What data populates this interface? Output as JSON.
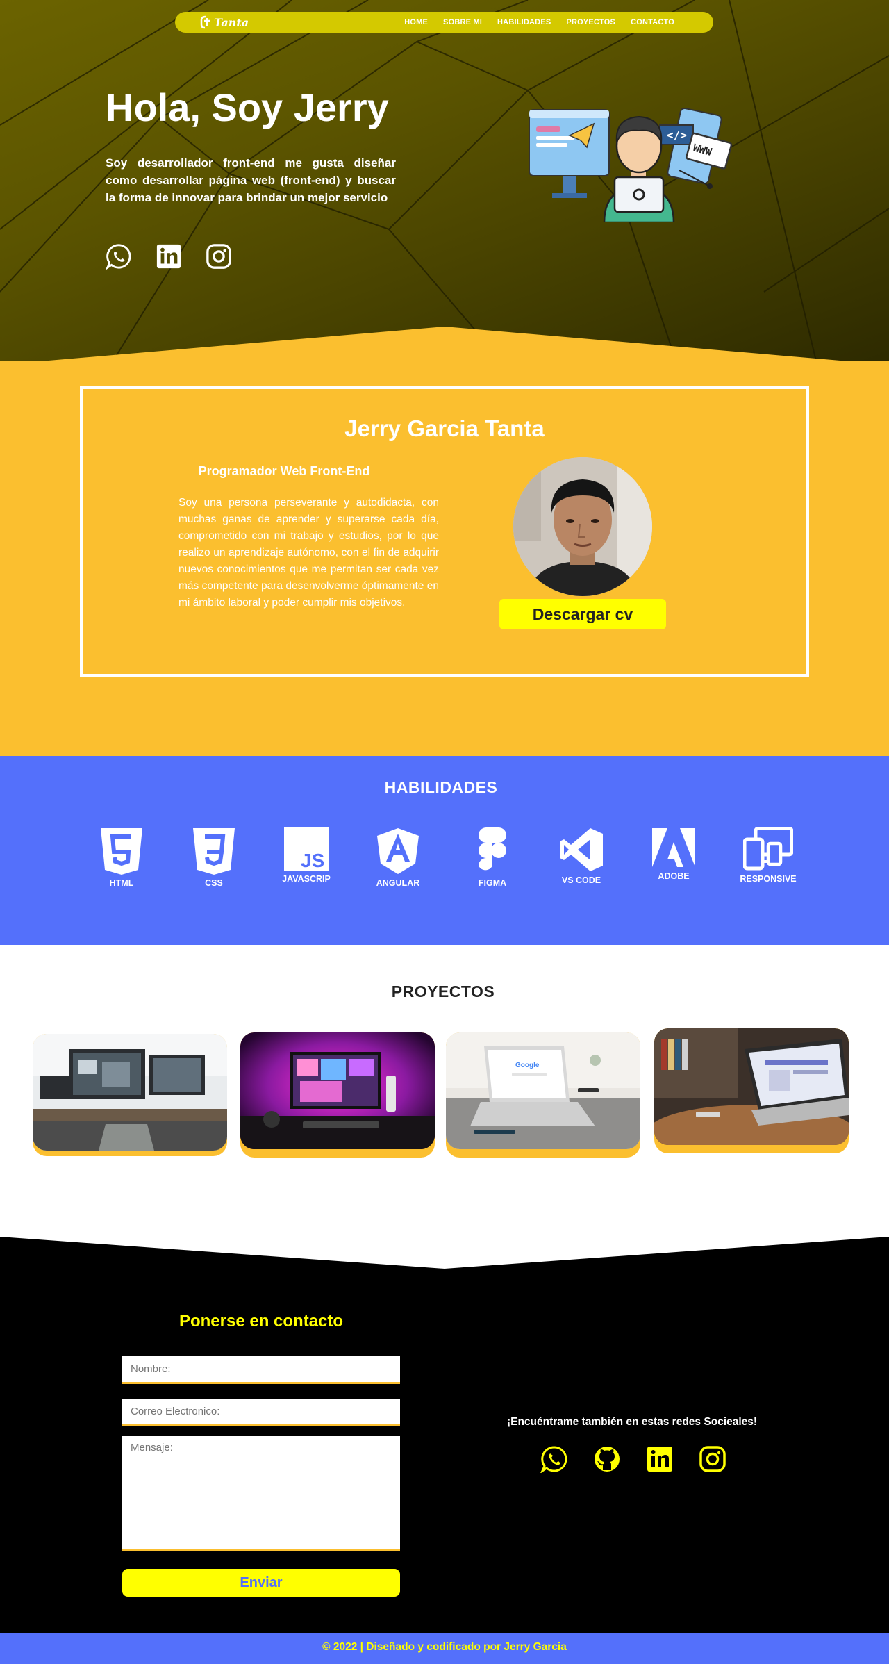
{
  "nav": {
    "logo": "Tanta",
    "links": [
      "HOME",
      "SOBRE MI",
      "HABILIDADES",
      "PROYECTOS",
      "CONTACTO"
    ]
  },
  "hero": {
    "title": "Hola, Soy Jerry",
    "text": "Soy desarrollador front-end me gusta diseñar como desarrollar página web (front-end) y buscar la forma de innovar para brindar un mejor servicio",
    "social_icons": [
      "whatsapp-icon",
      "linkedin-icon",
      "instagram-icon"
    ]
  },
  "about": {
    "name": "Jerry Garcia Tanta",
    "role": "Programador Web Front-End",
    "description": "Soy una persona perseverante y autodidacta, con muchas ganas de aprender y superarse cada día, comprometido con mi trabajo y estudios, por lo que realizo un aprendizaje autónomo, con el fin de adquirir nuevos conocimientos que me permitan ser cada vez más competente para desenvolverme óptimamente en mi ámbito laboral y poder cumplir mis objetivos.",
    "cv_button": "Descargar cv"
  },
  "skills": {
    "title": "HABILIDADES",
    "items": [
      "HTML",
      "CSS",
      "JAVASCRIP",
      "ANGULAR",
      "FIGMA",
      "VS CODE",
      "ADOBE",
      "RESPONSIVE"
    ]
  },
  "projects": {
    "title": "PROYECTOS"
  },
  "contact": {
    "title": "Ponerse en contacto",
    "name_placeholder": "Nombre:",
    "email_placeholder": "Correo Electronico:",
    "message_placeholder": "Mensaje:",
    "send_button": "Enviar",
    "social_caption": "¡Encuéntrame también en estas redes Socieales!",
    "social_icons": [
      "whatsapp-icon",
      "github-icon",
      "linkedin-icon",
      "instagram-icon"
    ]
  },
  "footer": {
    "text": "© 2022 | Diseñado y codificado por Jerry Garcia"
  },
  "colors": {
    "accent_yellow": "#ffff00",
    "about_bg": "#fbbf2f",
    "skills_bg": "#5470fb",
    "nav_bg": "#d4c900"
  }
}
